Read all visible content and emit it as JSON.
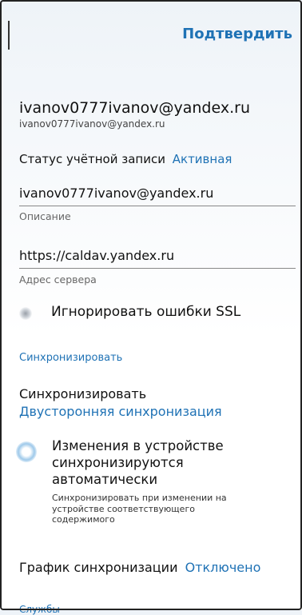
{
  "header": {
    "confirm_label": "Подтвердить"
  },
  "account": {
    "email_title": "ivanov0777ivanov@yandex.ru",
    "email_sub": "ivanov0777ivanov@yandex.ru",
    "status_label": "Статус учётной записи",
    "status_value": "Активная"
  },
  "fields": {
    "description_value": "ivanov0777ivanov@yandex.ru",
    "description_label": "Описание",
    "server_value": "https://caldav.yandex.ru",
    "server_label": "Адрес сервера"
  },
  "ssl": {
    "label": "Игнорировать ошибки SSL"
  },
  "sync": {
    "section_title": "Синхронизировать",
    "mode_label": "Синхронизировать",
    "mode_value": "Двусторонняя синхронизация",
    "auto_title": "Изменения в устройстве синхронизируются автоматически",
    "auto_subtitle": "Синхронизировать при изменении на устройстве соответствующего содержимого",
    "schedule_label": "График синхронизации",
    "schedule_value": "Отключено"
  },
  "services": {
    "section_title": "Службы"
  }
}
